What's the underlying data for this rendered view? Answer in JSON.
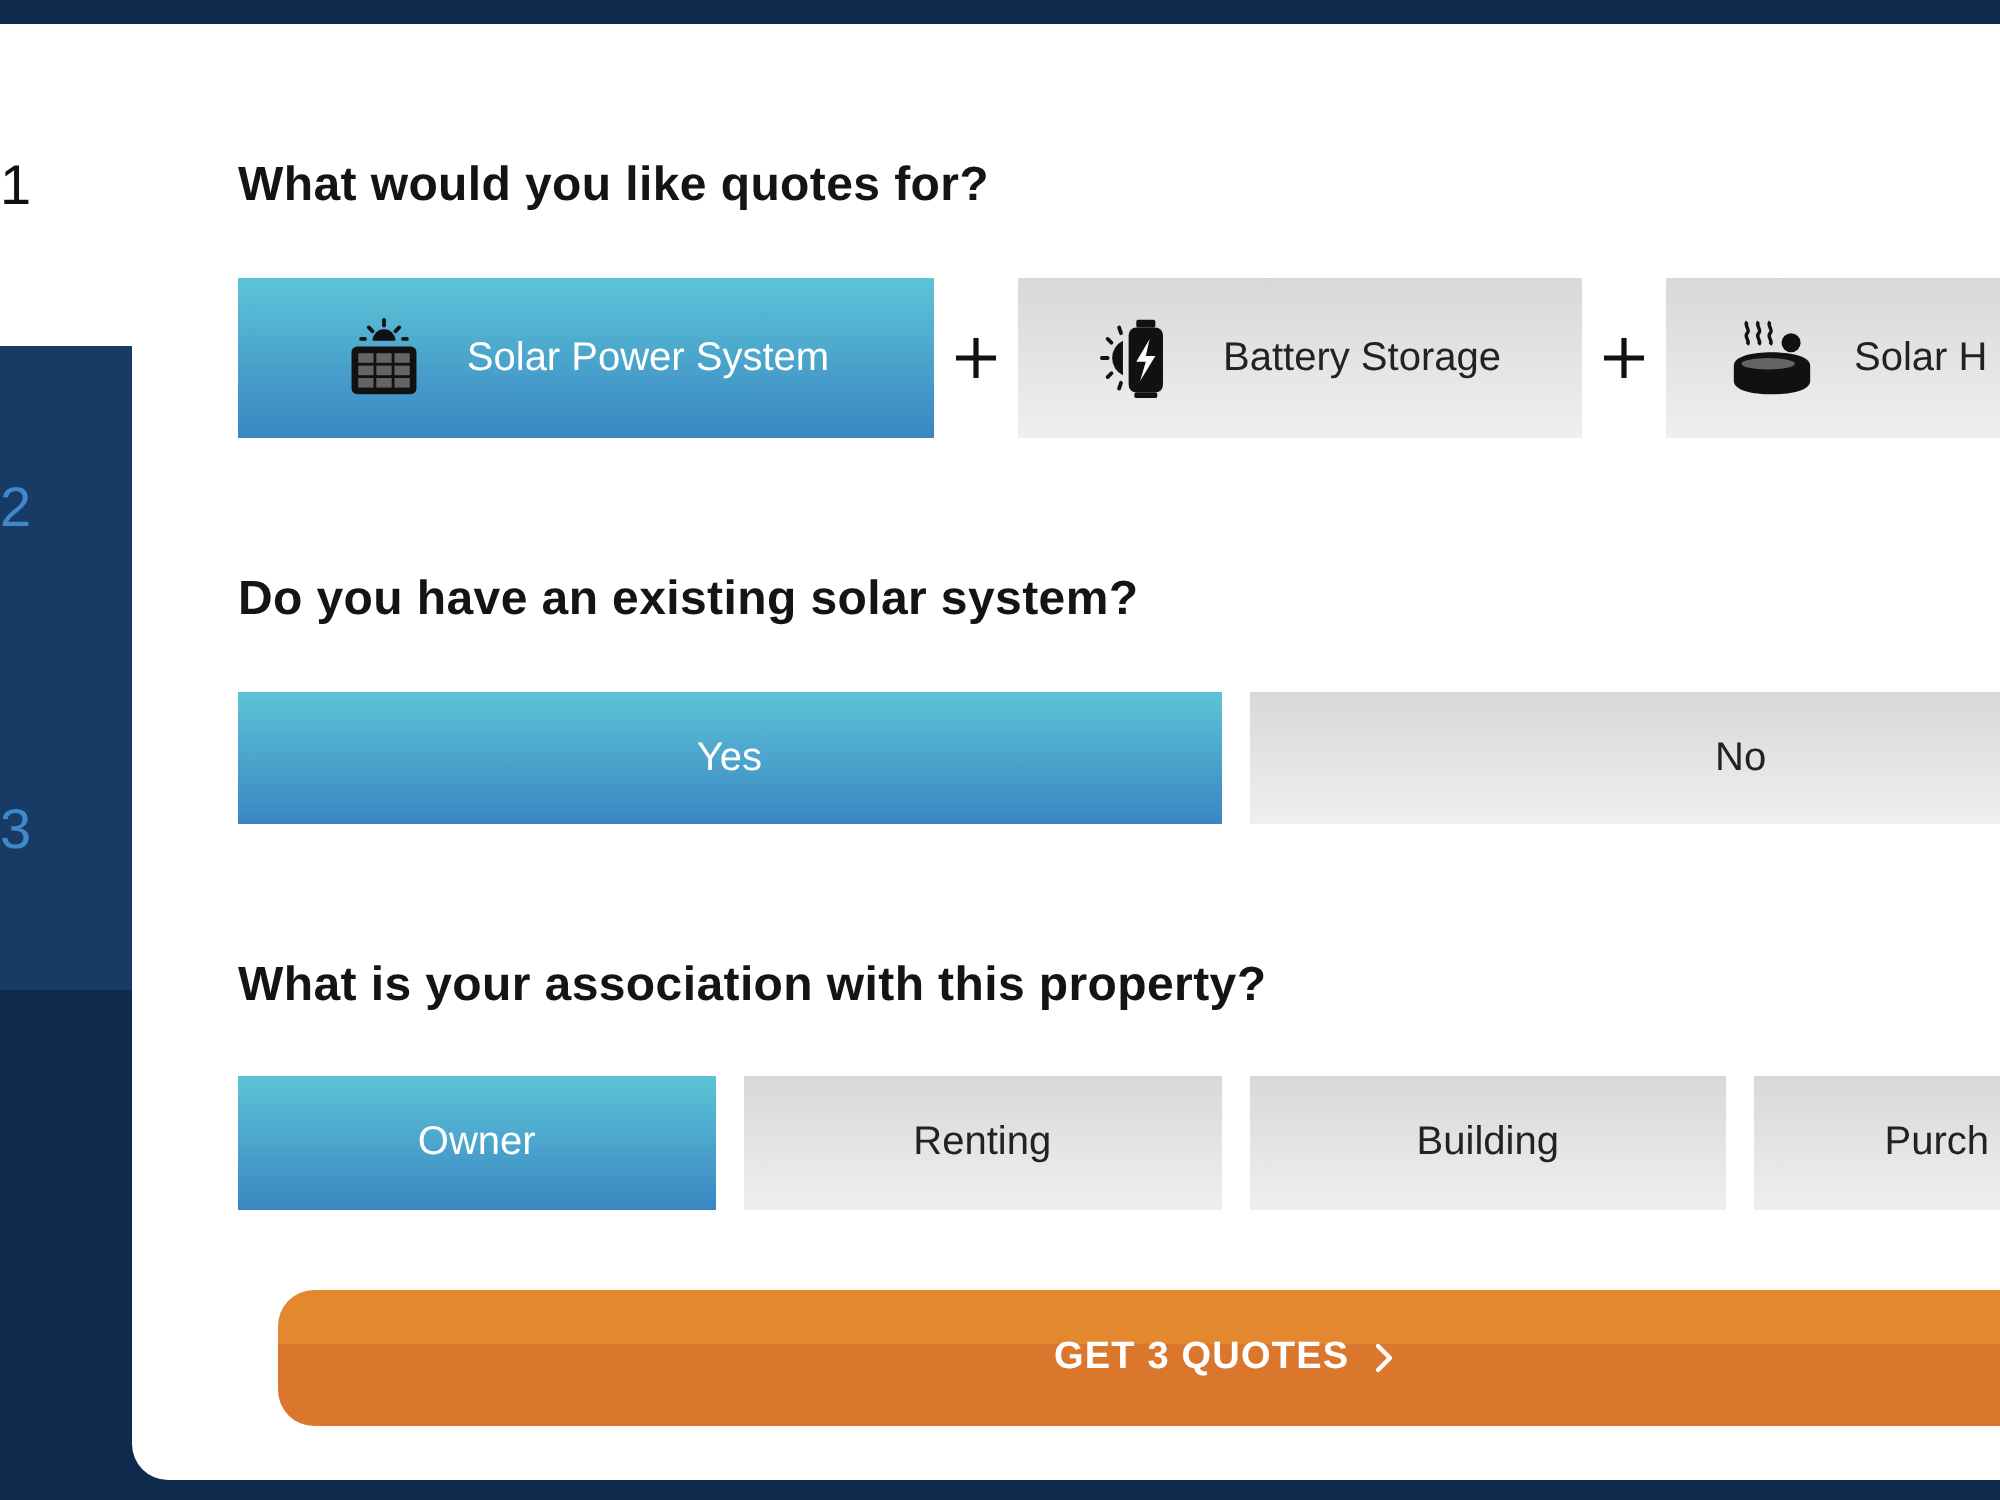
{
  "steps": [
    {
      "number": "1",
      "selected": true
    },
    {
      "number": "2",
      "selected": false
    },
    {
      "number": "3",
      "selected": false
    }
  ],
  "questions": [
    {
      "title": "What would you like quotes for?",
      "kind": "products",
      "options": [
        {
          "label": "Solar Power System",
          "selected": true
        },
        {
          "label": "Battery Storage",
          "selected": false
        },
        {
          "label": "Solar H",
          "selected": false
        }
      ]
    },
    {
      "title": "Do you have an existing solar system?",
      "kind": "choice",
      "options": [
        {
          "label": "Yes",
          "selected": true
        },
        {
          "label": "No",
          "selected": false
        }
      ]
    },
    {
      "title": "What is your association with this property?",
      "kind": "choice",
      "options": [
        {
          "label": "Owner",
          "selected": true
        },
        {
          "label": "Renting",
          "selected": false
        },
        {
          "label": "Building",
          "selected": false
        },
        {
          "label": "Purch",
          "selected": false
        }
      ]
    }
  ],
  "submit": {
    "label": "GET 3 QUOTES"
  }
}
